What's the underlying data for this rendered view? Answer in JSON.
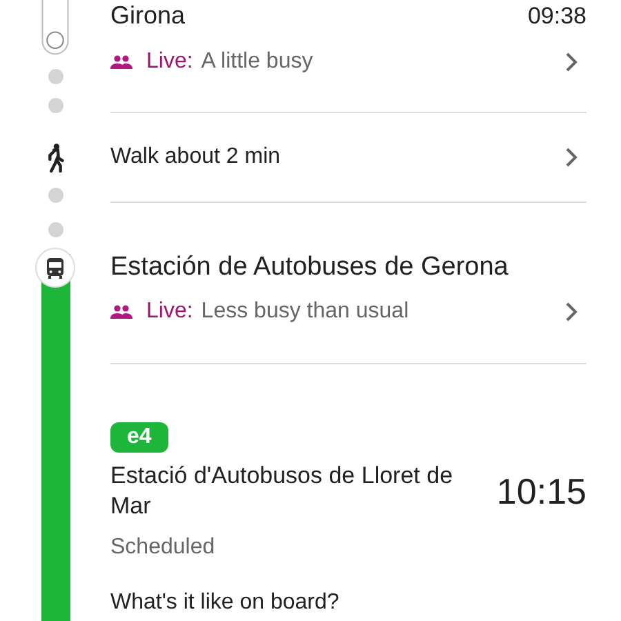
{
  "origin": {
    "name": "Girona",
    "time": "09:38",
    "live": {
      "label": "Live:",
      "status": "A little busy"
    }
  },
  "walk": {
    "text": "Walk about 2 min"
  },
  "boarding": {
    "name": "Estación de Autobuses de Gerona",
    "live": {
      "label": "Live:",
      "status": "Less busy than usual"
    }
  },
  "ride": {
    "line": "e4",
    "color": "#1db53a",
    "headsign": "Estació d'Autobusos de Lloret de Mar",
    "time": "10:15",
    "status": "Scheduled",
    "question": "What's it like on board?"
  }
}
